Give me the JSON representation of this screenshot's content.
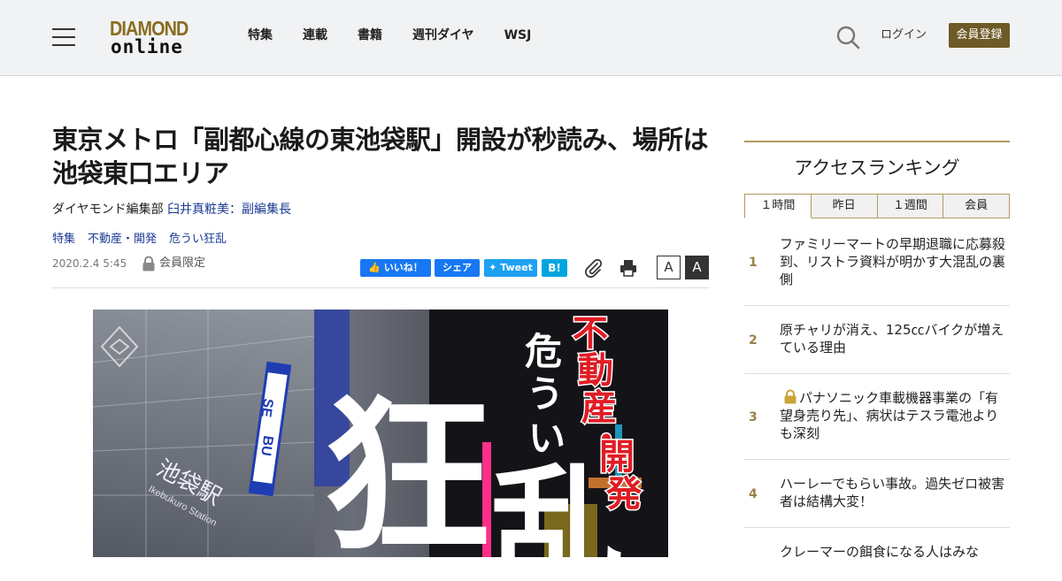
{
  "header": {
    "logo_top": "DIAMOND",
    "logo_bottom": "online",
    "nav": [
      "特集",
      "連載",
      "書籍",
      "週刊ダイヤ",
      "WSJ"
    ],
    "login": "ログイン",
    "register": "会員登録"
  },
  "article": {
    "title": "東京メトロ「副都心線の東池袋駅」開設が秒読み、場所は池袋東口エリア",
    "byline_prefix": "ダイヤモンド編集部 ",
    "author": "臼井真粧美：副編集長",
    "tags": [
      "特集",
      "不動産・開発",
      "危うい狂乱"
    ],
    "date": "2020.2.4 5:45",
    "members_only": "会員限定",
    "share": {
      "like": "いいね！",
      "share": "シェア",
      "tweet": "Tweet",
      "hatena": "B!"
    },
    "font_small": "A",
    "font_large": "A"
  },
  "hero": {
    "sign_top": "SE",
    "sign_bottom": "BU",
    "kanji_big1": "狂",
    "kanji_big2": "乱",
    "red_vertical": "不動産・開発",
    "white_vertical": "危うい",
    "station_jp": "池袋駅",
    "station_en": "Ikebukuro Station"
  },
  "ranking": {
    "heading": "アクセスランキング",
    "tabs": [
      "１時間",
      "昨日",
      "１週間",
      "会員"
    ],
    "active_tab": 0,
    "items": [
      {
        "rank": "1",
        "text": "ファミリーマートの早期退職に応募殺到、リストラ資料が明かす大混乱の裏側",
        "locked": false
      },
      {
        "rank": "2",
        "text": "原チャリが消え、125㏄バイクが増えている理由",
        "locked": false
      },
      {
        "rank": "3",
        "text": "パナソニック車載機器事業の「有望身売り先」、病状はテスラ電池よりも深刻",
        "locked": true
      },
      {
        "rank": "4",
        "text": "ハーレーでもらい事故。過失ゼロ被害者は結構大変！",
        "locked": false
      },
      {
        "rank": "",
        "text": "クレーマーの餌食になる人はみな",
        "locked": false
      }
    ]
  },
  "colors": {
    "gold": "#b39a5e",
    "register_bg": "#6e5a26",
    "link": "#1a3a94",
    "facebook": "#1877f2",
    "twitter": "#1da1f2",
    "hatena": "#00a4de"
  }
}
